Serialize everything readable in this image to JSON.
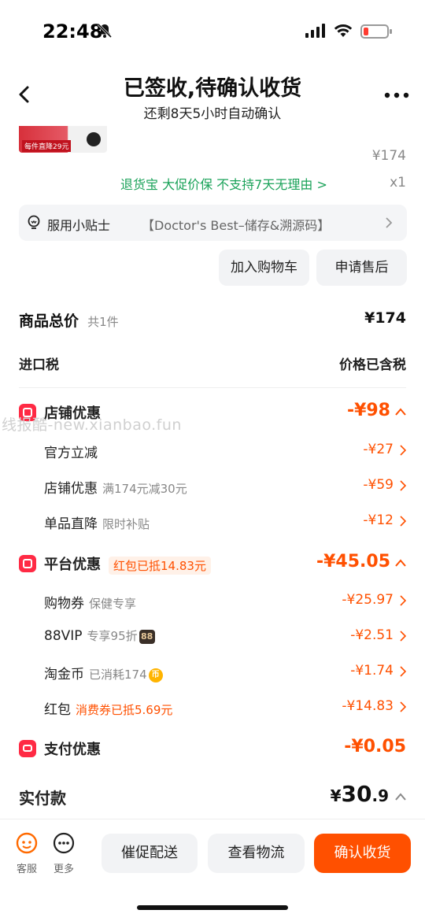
{
  "status_bar": {
    "time": "22:48"
  },
  "nav": {
    "title": "已签收,待确认收货",
    "subtitle": "还剩8天5小时自动确认"
  },
  "product": {
    "image_tag": "每件直降29元",
    "price": "¥174",
    "quantity": "x1",
    "services": "退货宝  大促价保  不支持7天无理由 >"
  },
  "tip": {
    "label": "服用小贴士",
    "content": "【Doctor's Best–储存&溯源码】"
  },
  "actions": {
    "add_cart": "加入购物车",
    "after_sale": "申请售后"
  },
  "summary": {
    "total_label": "商品总价",
    "total_count": "共1件",
    "total_value": "¥174",
    "tax_label": "进口税",
    "tax_value": "价格已含税"
  },
  "shop_discount": {
    "label": "店铺优惠",
    "value": "-¥98",
    "items": [
      {
        "label": "官方立减",
        "note": "",
        "value": "-¥27"
      },
      {
        "label": "店铺优惠",
        "note": "满174元减30元",
        "value": "-¥59"
      },
      {
        "label": "单品直降",
        "note": "限时补贴",
        "value": "-¥12"
      }
    ]
  },
  "platform_discount": {
    "label": "平台优惠",
    "pill": "红包已抵14.83元",
    "value": "-¥45.05",
    "items": [
      {
        "label": "购物券",
        "note": "保健专享",
        "value": "-¥25.97"
      },
      {
        "label": "88VIP",
        "note": "专享95折",
        "badge": "88",
        "value": "-¥2.51"
      },
      {
        "label": "淘金币",
        "note": "已消耗174",
        "badge": "币",
        "value": "-¥1.74"
      },
      {
        "label": "红包",
        "note": "消费券已抵5.69元",
        "value": "-¥14.83"
      }
    ]
  },
  "pay_discount": {
    "label": "支付优惠",
    "value": "-¥0.05"
  },
  "paid": {
    "label": "实付款",
    "currency": "¥",
    "int": "30",
    "dec": ".9"
  },
  "watermark": "线报酷-new.xianbao.fun",
  "bottom_bar": {
    "service": "客服",
    "more": "更多",
    "urge": "催促配送",
    "logistics": "查看物流",
    "confirm": "确认收货"
  },
  "colors": {
    "accent": "#ff5000",
    "green": "#1aa259",
    "red_icon": "#ff2a44"
  }
}
